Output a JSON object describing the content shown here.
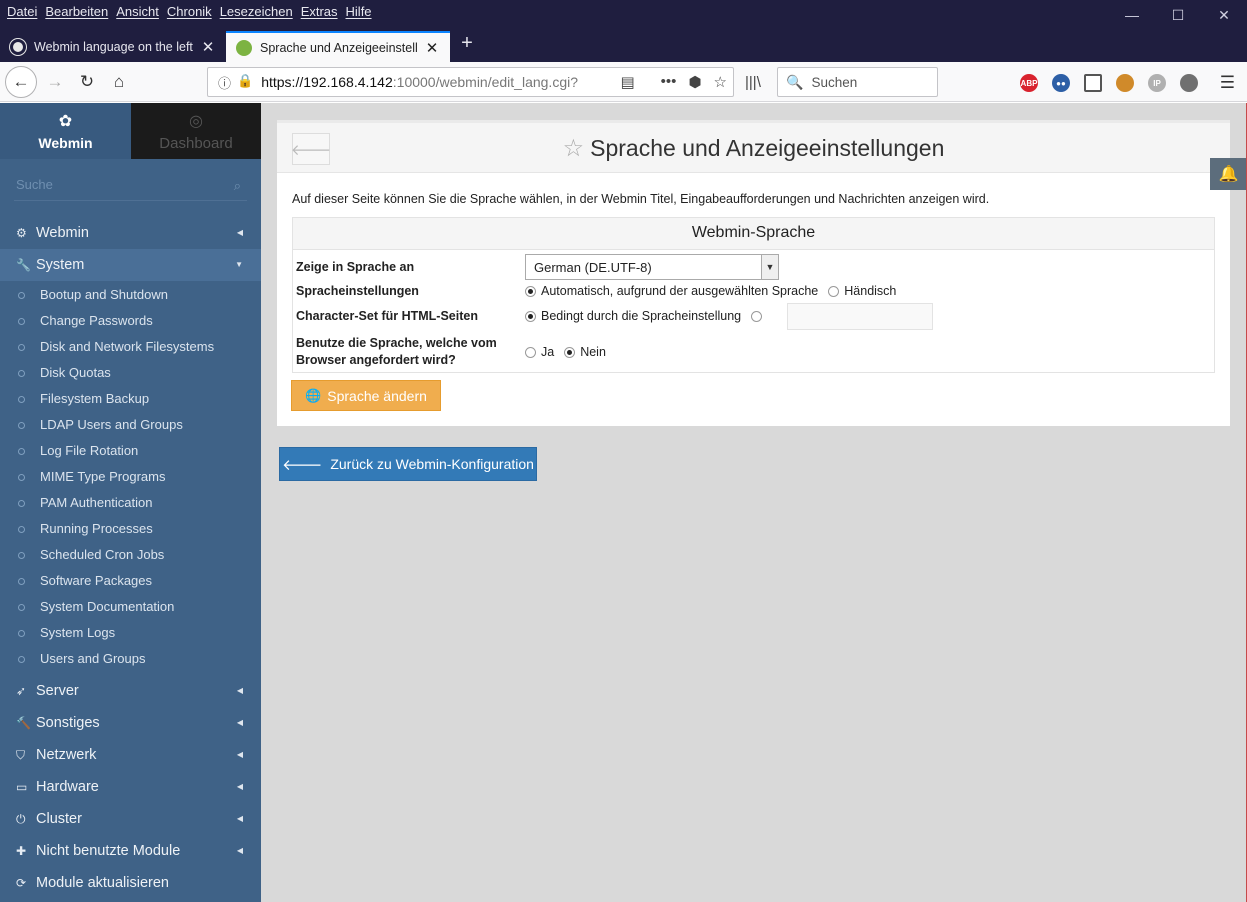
{
  "menubar": {
    "items": [
      "Datei",
      "Bearbeiten",
      "Ansicht",
      "Chronik",
      "Lesezeichen",
      "Extras",
      "Hilfe"
    ]
  },
  "window_controls": {
    "minimize": "—",
    "maximize": "☐",
    "close": "✕"
  },
  "tabs": [
    {
      "title": "Webmin language on the left -",
      "favicon": "github-icon",
      "active": false
    },
    {
      "title": "Sprache und Anzeigeeinstellun",
      "favicon": "webmin-icon",
      "active": true
    }
  ],
  "newtab": "+",
  "navbar": {
    "url_host": "https://192.168.4.142",
    "url_path": ":10000/webmin/edit_lang.cgi?",
    "search_placeholder": "Suchen",
    "extensions": [
      {
        "name": "adblock-plus-icon",
        "label": "ABP",
        "color": "#d9232e"
      },
      {
        "name": "dots-extension-icon",
        "label": "●●",
        "color": "#2d5fa6"
      },
      {
        "name": "sidebar-icon",
        "label": "",
        "color": "#555555"
      },
      {
        "name": "monkey-icon",
        "label": "",
        "color": "#d08a2a"
      },
      {
        "name": "ip-icon",
        "label": "IP",
        "color": "#b0b0b0"
      },
      {
        "name": "film-icon",
        "label": "",
        "color": "#707070"
      }
    ]
  },
  "sidebar": {
    "tab_webmin": "Webmin",
    "tab_dashboard": "Dashboard",
    "search_placeholder": "Suche",
    "categories": [
      {
        "label": "Webmin",
        "icon": "gear-icon",
        "open": false
      },
      {
        "label": "System",
        "icon": "wrench-icon",
        "open": true
      },
      {
        "label": "Server",
        "icon": "rocket-icon",
        "open": false
      },
      {
        "label": "Sonstiges",
        "icon": "wrench-icon",
        "open": false
      },
      {
        "label": "Netzwerk",
        "icon": "shield-icon",
        "open": false
      },
      {
        "label": "Hardware",
        "icon": "hdd-icon",
        "open": false
      },
      {
        "label": "Cluster",
        "icon": "power-icon",
        "open": false
      },
      {
        "label": "Nicht benutzte Module",
        "icon": "puzzle-icon",
        "open": false
      },
      {
        "label": "Module aktualisieren",
        "icon": "refresh-icon",
        "open": false
      }
    ],
    "system_items": [
      "Bootup and Shutdown",
      "Change Passwords",
      "Disk and Network Filesystems",
      "Disk Quotas",
      "Filesystem Backup",
      "LDAP Users and Groups",
      "Log File Rotation",
      "MIME Type Programs",
      "PAM Authentication",
      "Running Processes",
      "Scheduled Cron Jobs",
      "Software Packages",
      "System Documentation",
      "System Logs",
      "Users and Groups"
    ]
  },
  "page": {
    "title": "Sprache und Anzeigeeinstellungen",
    "intro": "Auf dieser Seite können Sie die Sprache wählen, in der Webmin Titel, Eingabeaufforderungen und Nachrichten anzeigen wird.",
    "table_header": "Webmin-Sprache",
    "row1_label": "Zeige in Sprache an",
    "row1_value": "German (DE.UTF-8)",
    "row2_label": "Spracheinstellungen",
    "row2_opt1": "Automatisch, aufgrund der ausgewählten Sprache",
    "row2_opt2": "Händisch",
    "row3_label": "Character-Set für HTML-Seiten",
    "row3_opt1": "Bedingt durch die Spracheinstellung",
    "row3_text_value": "",
    "row4_label_line1": "Benutze die Sprache, welche vom",
    "row4_label_line2": "Browser angefordert wird?",
    "row4_opt1": "Ja",
    "row4_opt2": "Nein",
    "submit_label": "Sprache ändern",
    "return_label": "Zurück zu Webmin-Konfiguration"
  }
}
